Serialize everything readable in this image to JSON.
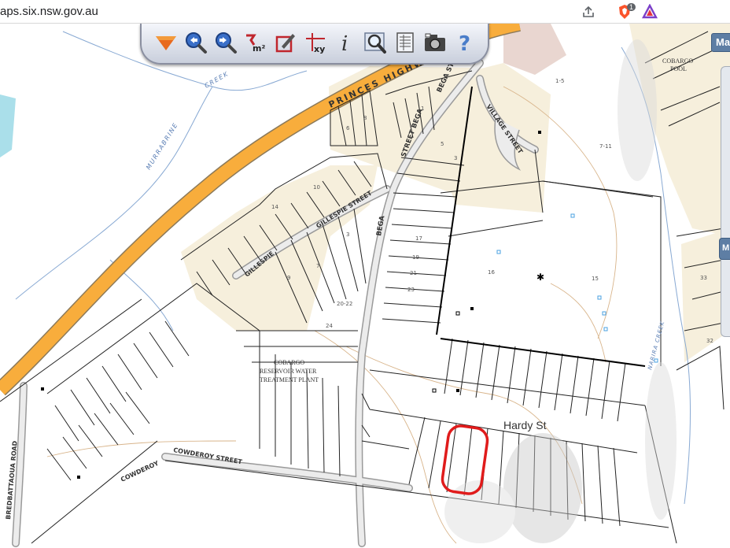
{
  "browser": {
    "url": "aps.six.nsw.gov.au",
    "icons": [
      "share-icon",
      "brave-shield-icon",
      "brave-rewards-icon"
    ],
    "shield_badge": "1"
  },
  "toolbar": {
    "tools": [
      {
        "name": "nsw-logo-icon"
      },
      {
        "name": "zoom-in-icon"
      },
      {
        "name": "zoom-out-icon"
      },
      {
        "name": "measure-area-icon",
        "text": "m²"
      },
      {
        "name": "draw-icon"
      },
      {
        "name": "coordinates-icon",
        "text": "xy"
      },
      {
        "name": "info-icon",
        "text": "i"
      },
      {
        "name": "search-icon"
      },
      {
        "name": "layers-list-icon"
      },
      {
        "name": "camera-icon"
      },
      {
        "name": "help-icon",
        "text": "?"
      }
    ]
  },
  "map": {
    "roads": {
      "princes_highway": "PRINCES HIGHWAY",
      "bega_street_a": "BEGA STREET",
      "bega_street_b": "STREET BEGA",
      "bega_lower": "BEGA",
      "village_street": "VILLAGE STREET",
      "gillespie_street": "GILLESPIE STREET",
      "gillespie_west": "GILLESPIE",
      "cowderoy": "COWDEROY",
      "cowderoy_street": "COWDEROY STREET",
      "bredbatta_road": "BREDBATTAOUA ROAD",
      "hardy_st": "Hardy St"
    },
    "water": {
      "murrabrine_creek_a": "MURRABRINE",
      "murrabrine_creek_b": "CREEK",
      "narira_creek": "NARIRA CREEK"
    },
    "places": {
      "reservoir_1": "COBARGO",
      "reservoir_2": "RESERVOIR WATER",
      "reservoir_3": "TREATMENT PLANT",
      "cobargo_top_1": "COBARGO",
      "cobargo_top_2": "POOL"
    },
    "lot_numbers": [
      "1-5",
      "7-11",
      "15",
      "16",
      "17",
      "19",
      "21",
      "23",
      "24",
      "20-22",
      "33",
      "32",
      "6",
      "8",
      "10",
      "14",
      "9",
      "7",
      "3",
      "5",
      "3",
      "1"
    ],
    "highlight_color": "#e01b1b",
    "highway_color": "#f8ad3c",
    "land_color": "#f6efdc"
  },
  "side_panel": {
    "tab_label": "Ma",
    "handle_label": "M"
  }
}
